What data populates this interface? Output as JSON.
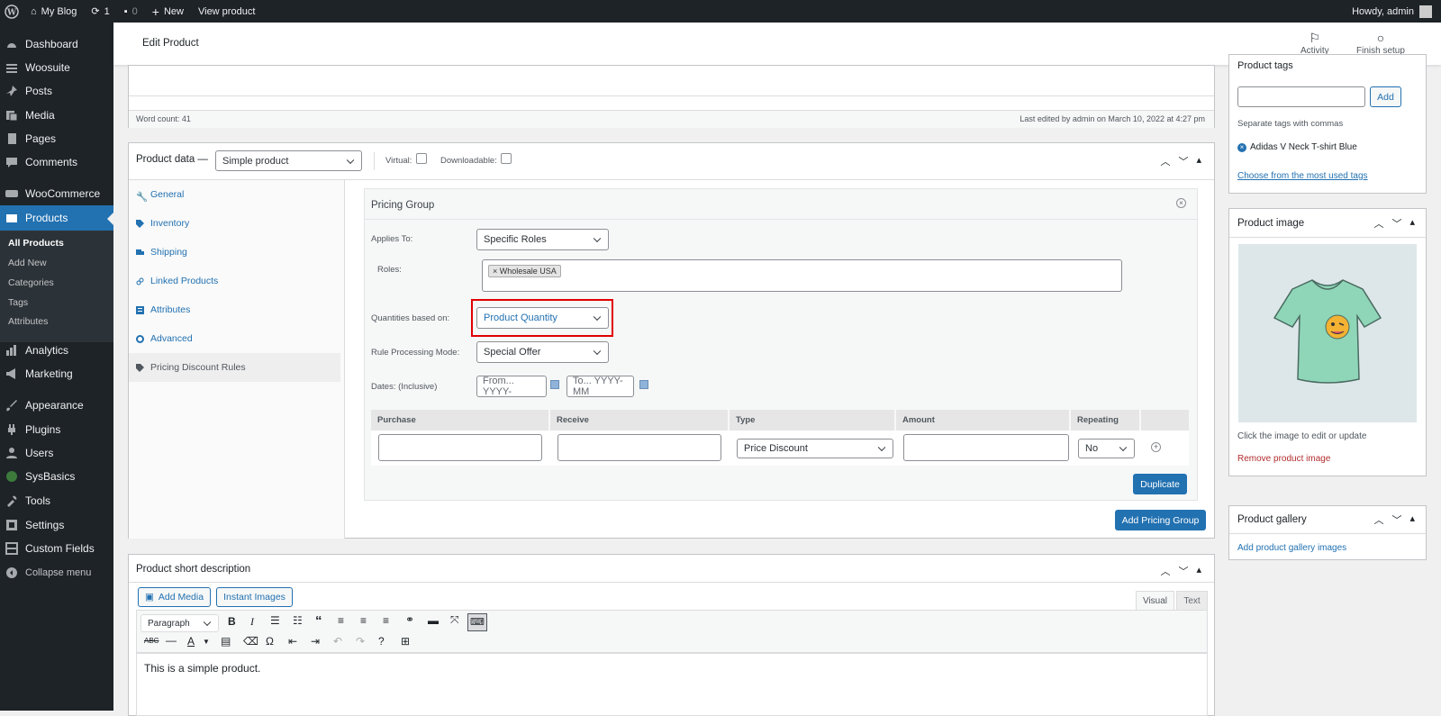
{
  "admin_bar": {
    "site_name": "My Blog",
    "updates_count": "1",
    "comments_count": "0",
    "new_label": "New",
    "view_product_label": "View product",
    "howdy": "Howdy, admin"
  },
  "sidebar": {
    "items": [
      {
        "label": "Dashboard",
        "icon": "dashboard-icon"
      },
      {
        "label": "Woosuite",
        "icon": "woosuite-icon"
      },
      {
        "label": "Posts",
        "icon": "pin-icon"
      },
      {
        "label": "Media",
        "icon": "media-icon"
      },
      {
        "label": "Pages",
        "icon": "pages-icon"
      },
      {
        "label": "Comments",
        "icon": "comment-icon"
      },
      {
        "label": "WooCommerce",
        "icon": "woo-icon"
      },
      {
        "label": "Products",
        "icon": "box-icon"
      },
      {
        "label": "Analytics",
        "icon": "bar-chart-icon"
      },
      {
        "label": "Marketing",
        "icon": "megaphone-icon"
      },
      {
        "label": "Appearance",
        "icon": "brush-icon"
      },
      {
        "label": "Plugins",
        "icon": "plug-icon"
      },
      {
        "label": "Users",
        "icon": "user-icon"
      },
      {
        "label": "SysBasics",
        "icon": "sysbasics-icon"
      },
      {
        "label": "Tools",
        "icon": "wrench-icon"
      },
      {
        "label": "Settings",
        "icon": "settings-icon"
      },
      {
        "label": "Custom Fields",
        "icon": "grid-icon"
      },
      {
        "label": "Collapse menu",
        "icon": "collapse-icon"
      }
    ],
    "submenu": [
      "All Products",
      "Add New",
      "Categories",
      "Tags",
      "Attributes"
    ]
  },
  "header": {
    "title": "Edit Product",
    "activity": "Activity",
    "finish_setup": "Finish setup"
  },
  "editor_top": {
    "word_count": "Word count: 41",
    "last_edited": "Last edited by admin on March 10, 2022 at 4:27 pm"
  },
  "product_data": {
    "title": "Product data —",
    "type": "Simple product",
    "virtual": "Virtual:",
    "downloadable": "Downloadable:",
    "tabs": [
      "General",
      "Inventory",
      "Shipping",
      "Linked Products",
      "Attributes",
      "Advanced",
      "Pricing Discount Rules"
    ]
  },
  "pricing_group": {
    "title": "Pricing Group",
    "applies_to_label": "Applies To:",
    "applies_to": "Specific Roles",
    "roles_label": "Roles:",
    "role_tag": "× Wholesale USA",
    "quantities_label": "Quantities based on:",
    "quantities": "Product Quantity",
    "mode_label": "Rule Processing Mode:",
    "mode": "Special Offer",
    "dates_label": "Dates: (Inclusive)",
    "from_placeholder": "From... YYYY-",
    "to_placeholder": "To... YYYY-MM",
    "columns": [
      "Purchase",
      "Receive",
      "Type",
      "Amount",
      "Repeating"
    ],
    "type_value": "Price Discount",
    "repeating_value": "No",
    "duplicate": "Duplicate",
    "add_group": "Add Pricing Group"
  },
  "short_desc": {
    "title": "Product short description",
    "add_media": "Add Media",
    "instant_images": "Instant Images",
    "visual_tab": "Visual",
    "text_tab": "Text",
    "format": "Paragraph",
    "content": "This is a simple product."
  },
  "tags_box": {
    "title": "Product tags",
    "add_button": "Add",
    "hint": "Separate tags with commas",
    "tag": "Adidas V Neck T-shirt Blue",
    "choose_link": "Choose from the most used tags"
  },
  "image_box": {
    "title": "Product image",
    "hint": "Click the image to edit or update",
    "remove_link": "Remove product image"
  },
  "gallery_box": {
    "title": "Product gallery",
    "add_link": "Add product gallery images"
  },
  "colors": {
    "accent": "#2271b1",
    "sidebar": "#1d2327",
    "highlight": "#e00000",
    "remove": "#b32d2e"
  }
}
